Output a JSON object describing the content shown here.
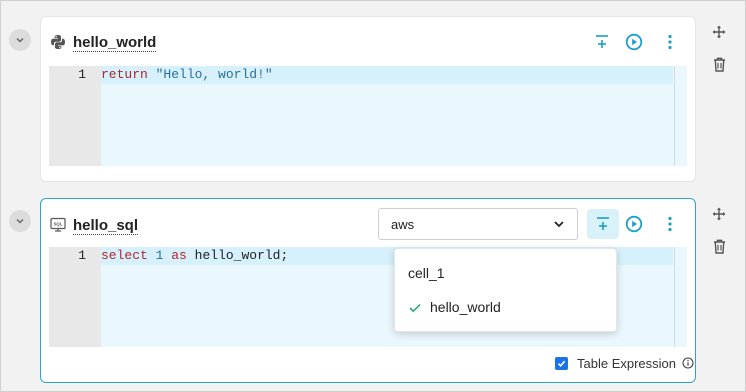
{
  "cells": [
    {
      "title": "hello_world",
      "language_icon": "python-icon",
      "line_number": "1",
      "code": [
        {
          "text": "return",
          "kind": "keyword"
        },
        {
          "text": " ",
          "kind": "plain"
        },
        {
          "text": "\"Hello, world!\"",
          "kind": "string"
        }
      ]
    },
    {
      "title": "hello_sql",
      "language_icon": "sql-icon",
      "line_number": "1",
      "connection": "aws",
      "code": [
        {
          "text": "select",
          "kind": "keyword"
        },
        {
          "text": " ",
          "kind": "plain"
        },
        {
          "text": "1",
          "kind": "number"
        },
        {
          "text": " ",
          "kind": "plain"
        },
        {
          "text": "as",
          "kind": "keyword"
        },
        {
          "text": " hello_world;",
          "kind": "plain"
        }
      ],
      "table_expression_label": "Table Expression",
      "table_expression_checked": true
    }
  ],
  "dropdown": {
    "items": [
      {
        "label": "cell_1",
        "selected": false
      },
      {
        "label": "hello_world",
        "selected": true
      }
    ]
  },
  "colors": {
    "accent": "#1a9fc9",
    "keyword": "#b0262e",
    "string": "#2a6f99",
    "checkbox": "#1a73e8"
  }
}
